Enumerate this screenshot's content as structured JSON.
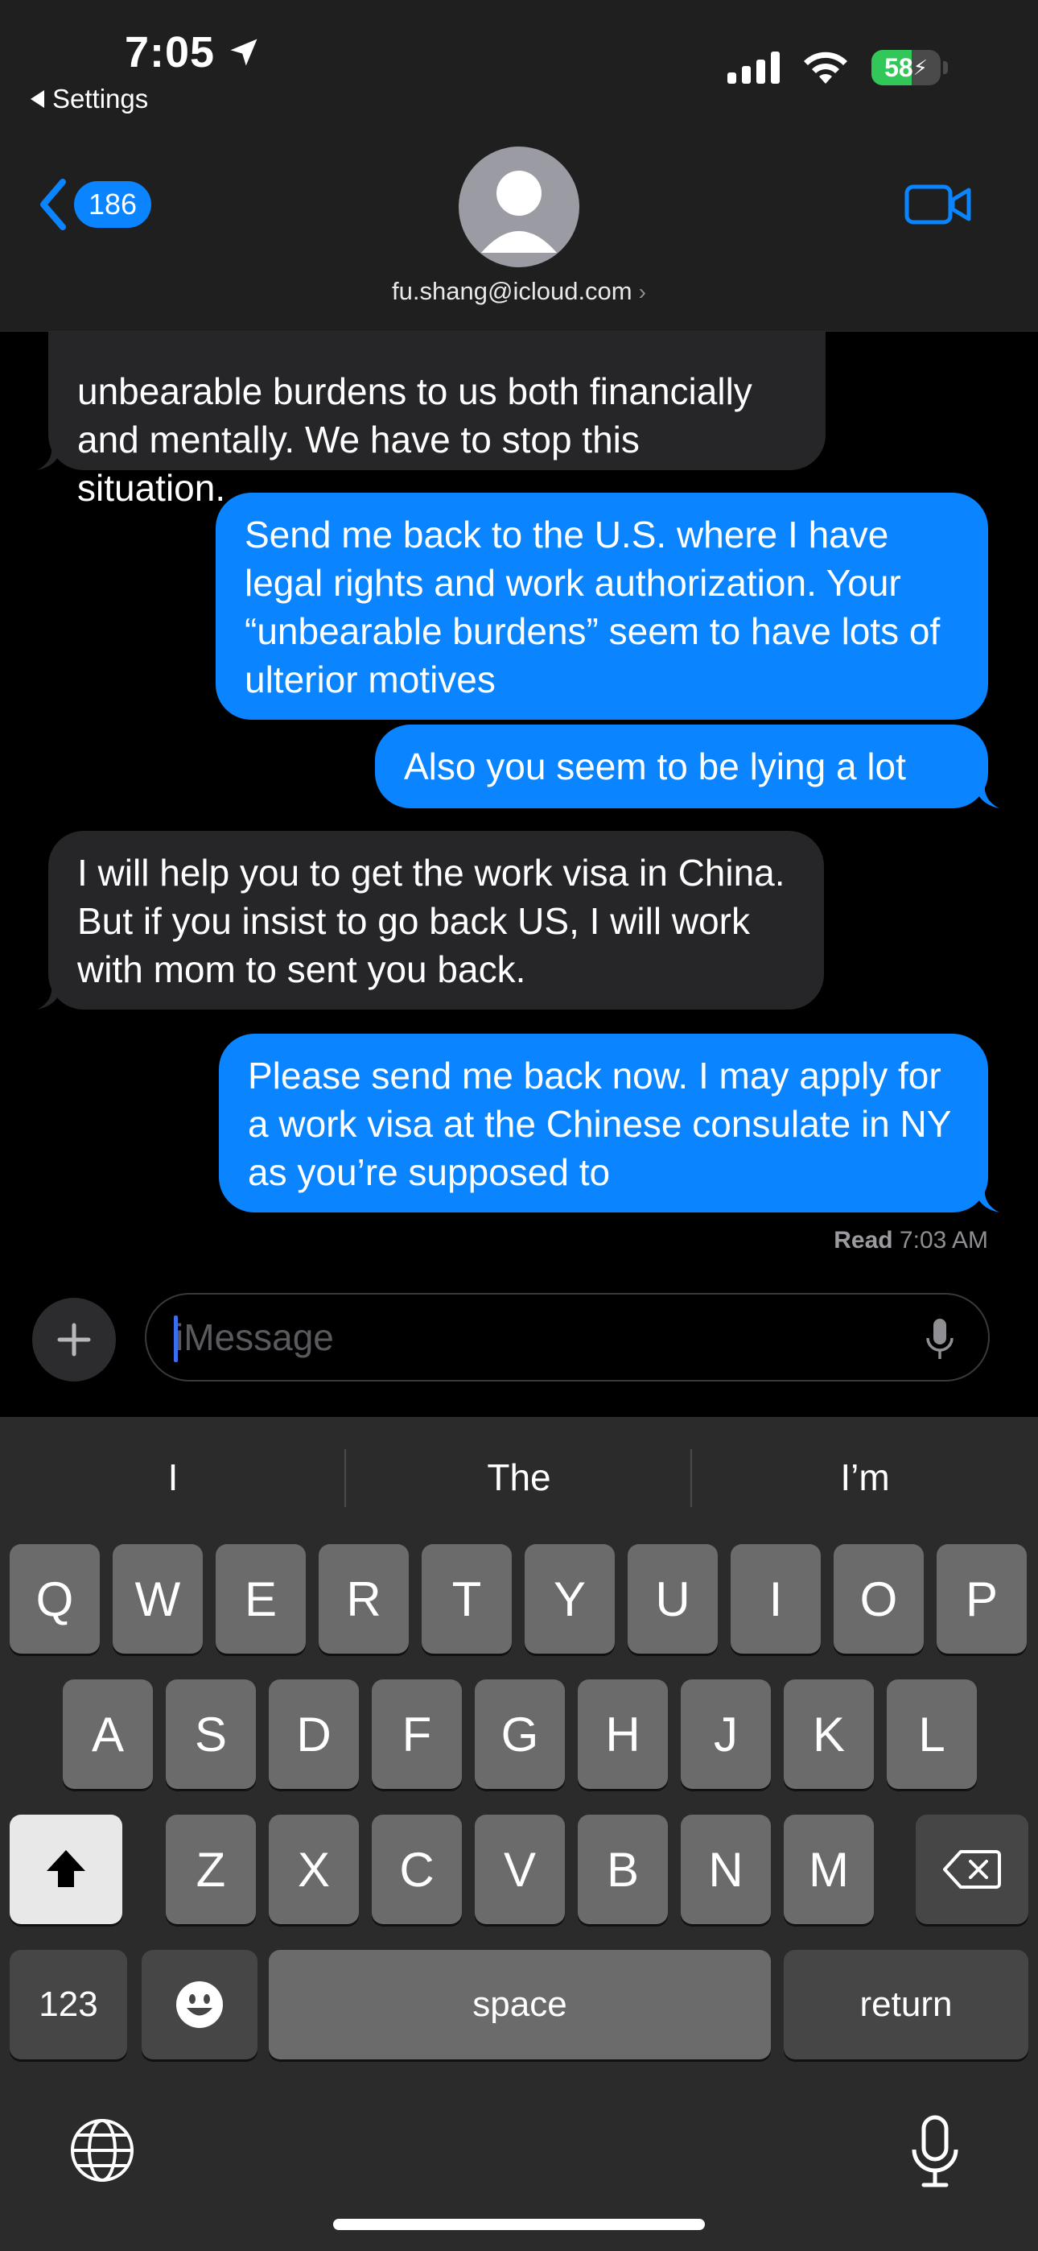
{
  "status_bar": {
    "time": "7:05",
    "back_app": "Settings",
    "battery": "58",
    "battery_level_percent": 58
  },
  "header": {
    "unread_count": "186",
    "contact": "fu.shang@icloud.com"
  },
  "messages": [
    {
      "dir": "in",
      "text": "unbearable burdens to us both financially and mentally. We have to stop this situation."
    },
    {
      "dir": "out",
      "text": "Send me back to the U.S. where I have legal rights and work authorization. Your “unbearable burdens” seem to have lots of ulterior motives"
    },
    {
      "dir": "out",
      "text": "Also you seem to be lying a lot"
    },
    {
      "dir": "in",
      "text": "I will help you to get the work visa in China. But if you insist to go back US, I will work with mom to sent you back."
    },
    {
      "dir": "out",
      "text": "Please send me back now. I may apply for a work visa at the Chinese consulate in NY as you’re supposed to"
    }
  ],
  "read_receipt": {
    "label": "Read",
    "time": "7:03 AM"
  },
  "composer": {
    "placeholder": "iMessage"
  },
  "keyboard": {
    "suggestions": [
      "I",
      "The",
      "I’m"
    ],
    "row1": [
      "Q",
      "W",
      "E",
      "R",
      "T",
      "Y",
      "U",
      "I",
      "O",
      "P"
    ],
    "row2": [
      "A",
      "S",
      "D",
      "F",
      "G",
      "H",
      "J",
      "K",
      "L"
    ],
    "row3": [
      "Z",
      "X",
      "C",
      "V",
      "B",
      "N",
      "M"
    ],
    "numbers_label": "123",
    "space_label": "space",
    "return_label": "return"
  },
  "colors": {
    "outgoing": "#0a84ff",
    "incoming": "#262629",
    "background": "#000000"
  }
}
